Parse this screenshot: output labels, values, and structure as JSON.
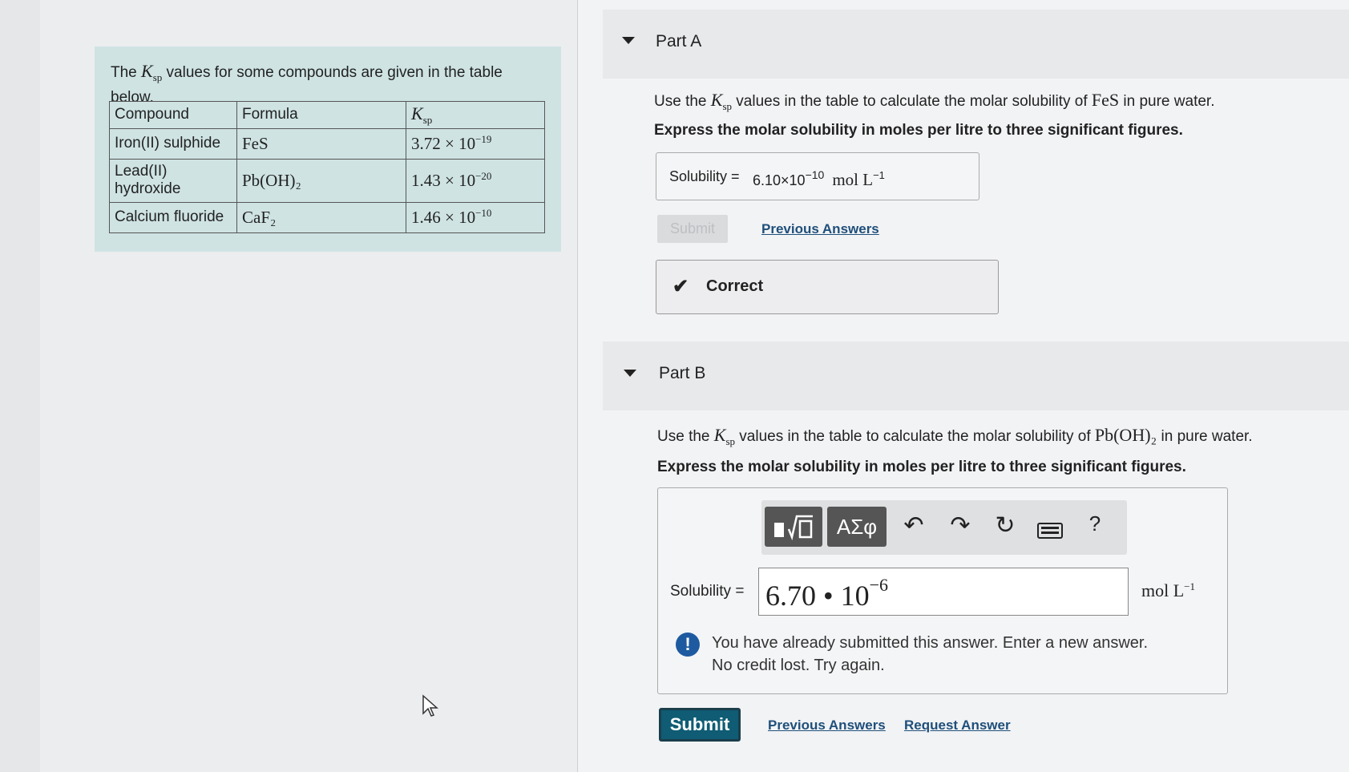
{
  "info": {
    "intro_pre": "The ",
    "ksp_symbol": "K",
    "ksp_sub": "sp",
    "intro_post": " values for some compounds are given in the table below.",
    "table": {
      "headers": [
        "Compound",
        "Formula"
      ],
      "rows": [
        {
          "compound": "Iron(II) sulphide",
          "formula": "FeS",
          "ksp_mantissa": "3.72 × 10",
          "ksp_exp": "−19"
        },
        {
          "compound": "Lead(II) hydroxide",
          "formula": "Pb(OH)₂",
          "ksp_mantissa": "1.43 × 10",
          "ksp_exp": "−20"
        },
        {
          "compound": "Calcium fluoride",
          "formula": "CaF₂",
          "ksp_mantissa": "1.46 × 10",
          "ksp_exp": "−10"
        }
      ]
    }
  },
  "partA": {
    "title": "Part A",
    "question_pre": "Use the ",
    "question_post": " values in the table to calculate the molar solubility of ",
    "question_compound": "FeS",
    "question_end": " in pure water.",
    "instruction": "Express the molar solubility in moles per litre to three significant figures.",
    "answer_label": "Solubility =",
    "answer_value": "6.10×10",
    "answer_exp": "−10",
    "answer_unit": "mol L",
    "answer_unit_exp": "−1",
    "submit_label": "Submit",
    "previous_answers": "Previous Answers",
    "feedback": "Correct"
  },
  "partB": {
    "title": "Part B",
    "question_pre": "Use the ",
    "question_post": " values in the table to calculate the molar solubility of ",
    "question_compound": "Pb(OH)₂",
    "question_end": " in pure water.",
    "instruction": "Express the molar solubility in moles per litre to three significant figures.",
    "toolbar": {
      "template_icon": "template-icon",
      "symbols_label": "ΑΣφ",
      "undo_icon": "undo-icon",
      "redo_icon": "redo-icon",
      "reset_icon": "reset-icon",
      "keyboard_icon": "keyboard-icon",
      "help_label": "?"
    },
    "answer_label": "Solubility =",
    "input_value": "6.70 • 10",
    "input_exp": "−6",
    "unit": "mol L",
    "unit_exp": "−1",
    "warning_line1": "You have already submitted this answer. Enter a new answer.",
    "warning_line2": "No credit lost. Try again.",
    "submit_label": "Submit",
    "previous_answers": "Previous Answers",
    "request_answer": "Request Answer"
  }
}
